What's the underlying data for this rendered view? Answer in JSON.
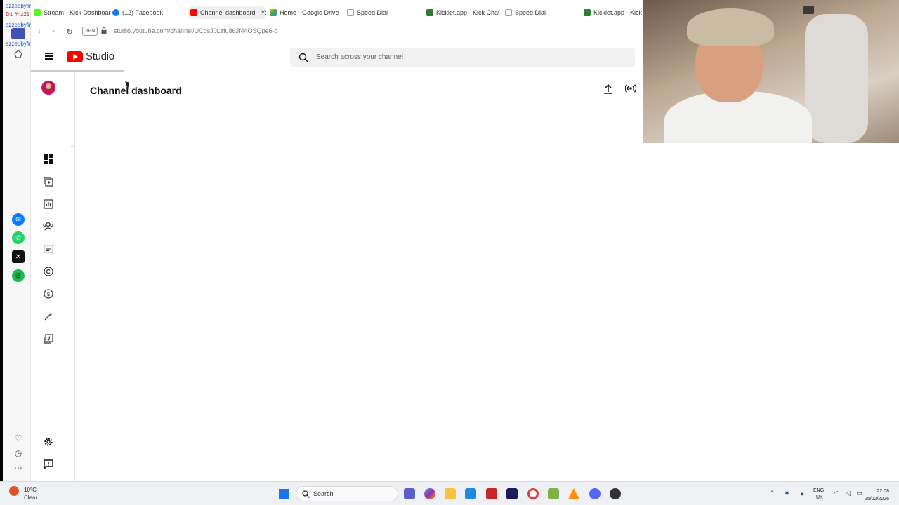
{
  "tabs": [
    {
      "title": "Stream - Kick Dashboard",
      "active": false,
      "favicon_color": "#53fc18"
    },
    {
      "title": "(12) Facebook",
      "active": false,
      "favicon_color": "#1877f2"
    },
    {
      "title": "Channel dashboard - You",
      "active": true,
      "favicon_color": "#ff0000"
    },
    {
      "title": "Home - Google Drive",
      "active": false,
      "favicon_color": "#34a853"
    },
    {
      "title": "Speed Dial",
      "active": false,
      "favicon_color": "#9aa0a6"
    },
    {
      "title": "Kicklet.app - Kick Chatbot",
      "active": false,
      "favicon_color": "#2e7d32"
    },
    {
      "title": "Speed Dial",
      "active": false,
      "favicon_color": "#9aa0a6"
    },
    {
      "title": "Kicklet.app - Kick Ch",
      "active": false,
      "favicon_color": "#2e7d32"
    }
  ],
  "address_bar": {
    "vpn_label": "VPN",
    "url": "studio.youtube.com/channel/UCosJ0Lzfu86Jf44OSQpe6-g"
  },
  "overlay": {
    "line1": "azzedbyfinn",
    "line2": "D1 #nz21",
    "line3": "azzedbyfinn",
    "line4": "azzedbyfinn"
  },
  "studio": {
    "logo_text": "Studio",
    "search_placeholder": "Search across your channel",
    "page_title": "Channel dashboard"
  },
  "sidebar_icons": [
    "dashboard-icon",
    "content-icon",
    "analytics-icon",
    "community-icon",
    "subtitles-icon",
    "copyright-icon",
    "earn-icon",
    "customization-icon",
    "audio-library-icon",
    "settings-icon",
    "feedback-icon"
  ],
  "taskbar": {
    "temperature": "10°C",
    "weather": "Clear",
    "search_label": "Search",
    "language_line1": "ENG",
    "language_line2": "UK",
    "time": "22:08",
    "date": "25/02/2026"
  },
  "colors": {
    "youtube_red": "#ff0000",
    "spotify_green": "#1db954",
    "messenger_blue": "#0a7cff",
    "whatsapp_green": "#25d366"
  }
}
